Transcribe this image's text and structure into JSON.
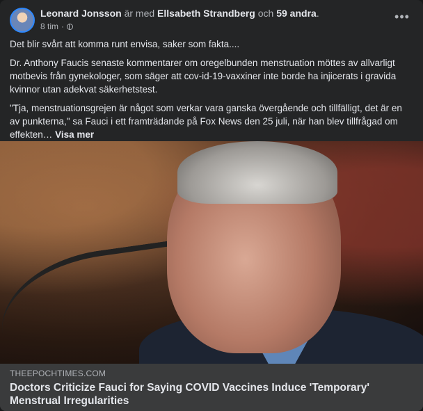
{
  "post": {
    "author": "Leonard Jonsson",
    "with_word": "är med",
    "tagged": "Ellsabeth Strandberg",
    "and_word": "och",
    "others": "59 andra",
    "period": ".",
    "time": "8 tim",
    "separator": "·",
    "privacy_icon": "globe-icon",
    "more_icon": "more-options-icon",
    "more_glyph": "•••",
    "paragraphs": [
      "Det blir svårt att komma runt envisa, saker som fakta....",
      "Dr. Anthony Faucis senaste kommentarer om oregelbunden menstruation möttes av allvarligt motbevis från gynekologer, som säger att cov-id-19-vaxxiner inte borde ha injicerats i gravida kvinnor utan adekvat säkerhetstest.",
      "\"Tja, menstruationsgrejen är något som verkar vara ganska övergående och tillfälligt, det är en av punkterna,\" sa Fauci i ett framträdande på Fox News  den 25 juli, när han blev tillfrågad om effekten…"
    ],
    "see_more": "Visa mer"
  },
  "link_preview": {
    "domain": "THEEPOCHTIMES.COM",
    "title": "Doctors Criticize Fauci for Saying COVID Vaccines Induce 'Temporary' Menstrual Irregularities"
  },
  "colors": {
    "card_bg": "#242526",
    "link_bg": "#3a3b3c",
    "primary_text": "#e4e6eb",
    "secondary_text": "#b0b3b8"
  }
}
